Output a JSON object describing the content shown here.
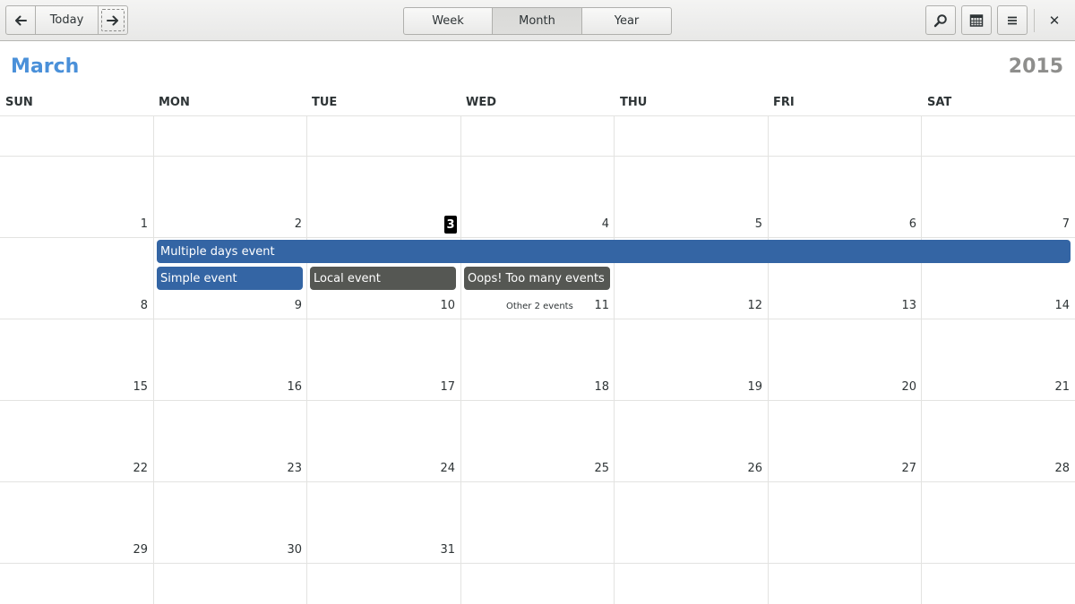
{
  "header": {
    "today_label": "Today",
    "views": [
      {
        "label": "Week",
        "active": false
      },
      {
        "label": "Month",
        "active": true
      },
      {
        "label": "Year",
        "active": false
      }
    ],
    "icons": {
      "prev": "arrow-left-icon",
      "next": "arrow-right-icon",
      "search": "search-icon",
      "calendars": "calendar-grid-icon",
      "menu": "hamburger-menu-icon",
      "close": "close-icon"
    },
    "close_glyph": "✕"
  },
  "calendar": {
    "month": "March",
    "year": "2015",
    "weekdays": [
      "SUN",
      "MON",
      "TUE",
      "WED",
      "THU",
      "FRI",
      "SAT"
    ],
    "today": "3",
    "weeks": [
      [
        "1",
        "2",
        "3",
        "4",
        "5",
        "6",
        "7"
      ],
      [
        "8",
        "9",
        "10",
        "11",
        "12",
        "13",
        "14"
      ],
      [
        "15",
        "16",
        "17",
        "18",
        "19",
        "20",
        "21"
      ],
      [
        "22",
        "23",
        "24",
        "25",
        "26",
        "27",
        "28"
      ],
      [
        "29",
        "30",
        "31",
        "",
        "",
        "",
        ""
      ]
    ],
    "events": {
      "multi_day": "Multiple days event",
      "simple": "Simple event",
      "local": "Local event",
      "oops": "Oops! Too many events",
      "more": "Other 2 events"
    },
    "colors": {
      "accent": "#4a90d9",
      "event_blue": "#3465a4",
      "event_gray": "#555753",
      "today_badge": "#000000"
    }
  }
}
